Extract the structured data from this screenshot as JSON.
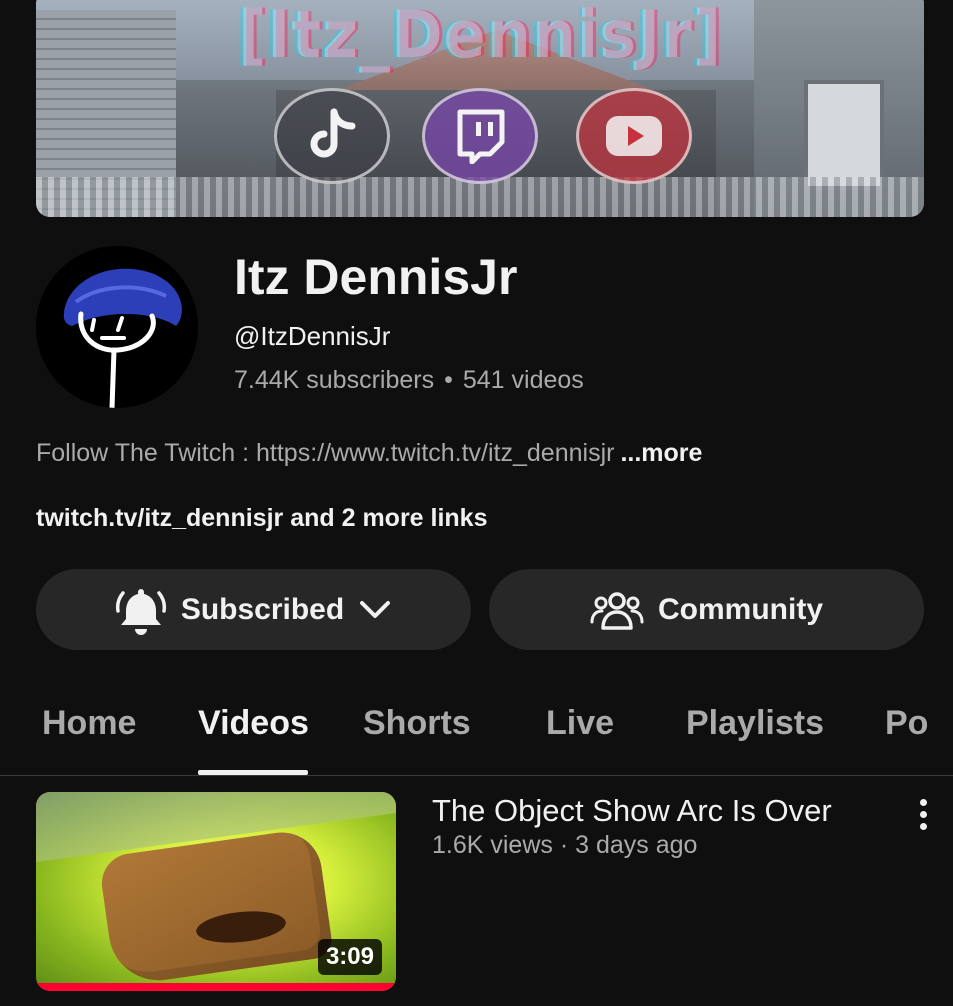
{
  "banner": {
    "title": "[Itz_DennisJr]",
    "social_icons": [
      "tiktok-icon",
      "twitch-icon",
      "youtube-icon"
    ]
  },
  "channel": {
    "name": "Itz DennisJr",
    "handle": "@ItzDennisJr",
    "subscribers": "7.44K subscribers",
    "separator": "•",
    "videos": "541 videos",
    "description": "Follow The Twitch : https://www.twitch.tv/itz_dennisjr",
    "more_label": "...more",
    "links_text": "twitch.tv/itz_dennisjr and 2 more links"
  },
  "actions": {
    "subscribed_label": "Subscribed",
    "community_label": "Community"
  },
  "tabs": [
    {
      "label": "Home",
      "active": false
    },
    {
      "label": "Videos",
      "active": true
    },
    {
      "label": "Shorts",
      "active": false
    },
    {
      "label": "Live",
      "active": false
    },
    {
      "label": "Playlists",
      "active": false
    },
    {
      "label": "Po",
      "active": false
    }
  ],
  "videos": [
    {
      "title": "The Object Show Arc Is Over",
      "meta": "1.6K views · 3 days ago",
      "duration": "3:09",
      "watched_fraction": 1.0
    }
  ],
  "colors": {
    "background": "#0f0f0f",
    "button_bg": "#272727",
    "text_primary": "#f1f1f1",
    "text_secondary": "#aaaaaa",
    "progress": "#ff0033"
  }
}
